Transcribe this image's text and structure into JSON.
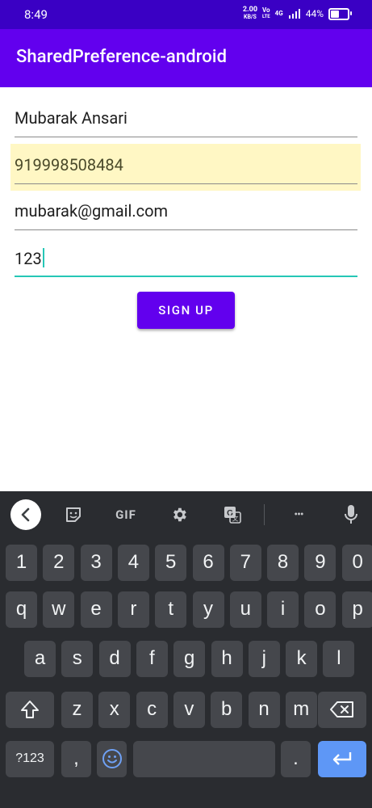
{
  "status_bar": {
    "time": "8:49",
    "net_speed_value": "2.00",
    "net_speed_unit": "KB/S",
    "volte_top": "Vo",
    "volte_bottom": "LTE",
    "network_type": "4G",
    "battery_percent": "44%",
    "battery_level": 0.44
  },
  "app_bar": {
    "title": "SharedPreference-android"
  },
  "form": {
    "name": {
      "value": "Mubarak Ansari"
    },
    "phone": {
      "value": "919998508484"
    },
    "email": {
      "value": "mubarak@gmail.com"
    },
    "password": {
      "value": "123"
    },
    "signup_label": "SIGN UP"
  },
  "keyboard": {
    "toolbar": {
      "back_icon": "chevron-left-icon",
      "sticker_icon": "sticker-icon",
      "gif_label": "GIF",
      "settings_icon": "gear-icon",
      "translate_icon": "translate-icon",
      "more_label": "•••",
      "mic_icon": "mic-icon"
    },
    "rows": {
      "numbers": [
        "1",
        "2",
        "3",
        "4",
        "5",
        "6",
        "7",
        "8",
        "9",
        "0"
      ],
      "row1": [
        "q",
        "w",
        "e",
        "r",
        "t",
        "y",
        "u",
        "i",
        "o",
        "p"
      ],
      "row2": [
        "a",
        "s",
        "d",
        "f",
        "g",
        "h",
        "j",
        "k",
        "l"
      ],
      "row3": [
        "z",
        "x",
        "c",
        "v",
        "b",
        "n",
        "m"
      ]
    },
    "symbols_label": "?123",
    "comma_label": ",",
    "period_label": ".",
    "colors": {
      "background": "#2a2c30",
      "key": "#45474c",
      "enter": "#5e97f6"
    }
  },
  "colors": {
    "primary": "#6200ee",
    "status_bar": "#3a00c4",
    "accent": "#26c7b6",
    "autofill": "#fff7c4"
  }
}
